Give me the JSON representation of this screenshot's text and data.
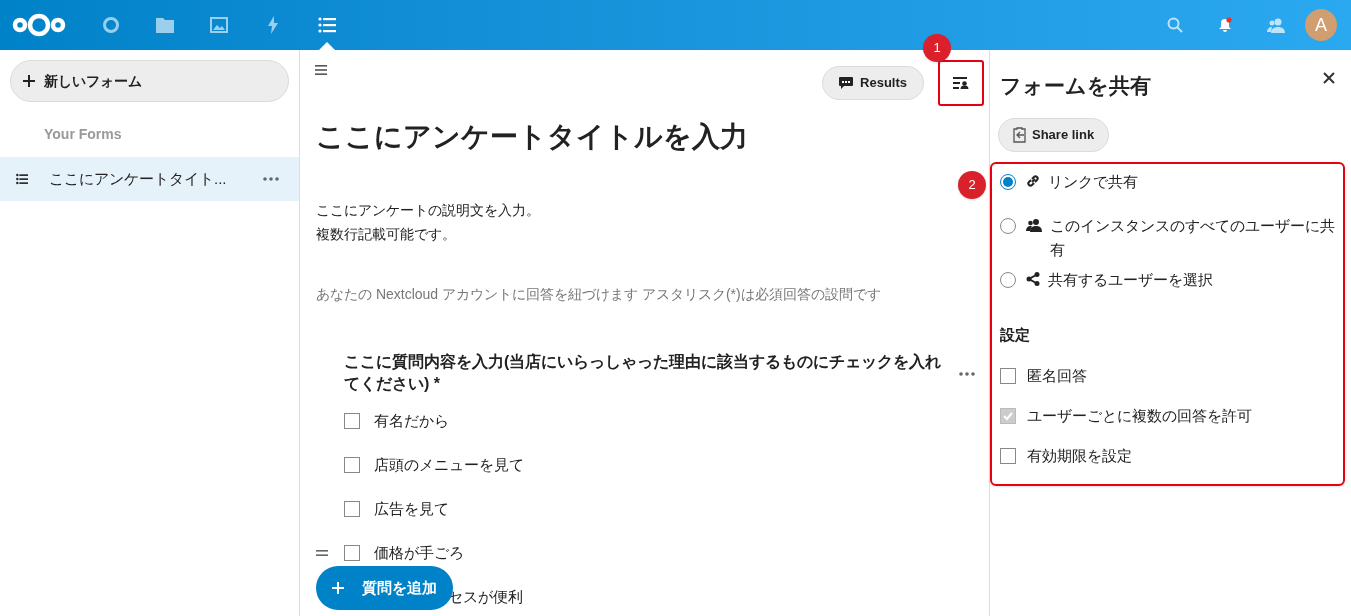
{
  "header": {
    "apps": [
      {
        "kind": "circle",
        "selected": false
      },
      {
        "kind": "folder",
        "selected": false
      },
      {
        "kind": "image",
        "selected": false
      },
      {
        "kind": "bolt",
        "selected": false
      },
      {
        "kind": "list",
        "selected": true
      }
    ],
    "avatar": "A",
    "notification": true
  },
  "sidebar": {
    "new_button": "新しいフォーム",
    "section": "Your Forms",
    "items": [
      {
        "title": "ここにアンケートタイト...",
        "selected": true
      }
    ]
  },
  "main": {
    "results_button": "Results",
    "title": "ここにアンケートタイトルを入力",
    "description": [
      "ここにアンケートの説明文を入力。",
      "複数行記載可能です。"
    ],
    "info": "あなたの Nextcloud アカウントに回答を紐づけます アスタリスク(*)は必須回答の設問です",
    "question": {
      "text": "ここに質問内容を入力(当店にいらっしゃった理由に該当するものにチェックを入れてください) *",
      "options": [
        {
          "label": "有名だから",
          "checked": false
        },
        {
          "label": "店頭のメニューを見て",
          "checked": false
        },
        {
          "label": "広告を見て",
          "checked": false
        },
        {
          "label": "価格が手ごろ",
          "checked": false
        }
      ],
      "covered_option": "セスが便利"
    },
    "add_button": "質問を追加"
  },
  "share_panel": {
    "title": "フォームを共有",
    "share_link_button": "Share link",
    "options": [
      {
        "label": "リンクで共有",
        "kind": "link",
        "selected": true
      },
      {
        "label": "このインスタンスのすべてのユーザーに共有",
        "kind": "group",
        "selected": false
      },
      {
        "label": "共有するユーザーを選択",
        "kind": "share",
        "selected": false
      }
    ],
    "settings_title": "設定",
    "settings": [
      {
        "label": "匿名回答",
        "checked": false,
        "disabled": false
      },
      {
        "label": "ユーザーごとに複数の回答を許可",
        "checked": true,
        "disabled": true
      },
      {
        "label": "有効期限を設定",
        "checked": false,
        "disabled": false
      }
    ]
  },
  "annotations": [
    {
      "number": "1"
    },
    {
      "number": "2"
    }
  ]
}
